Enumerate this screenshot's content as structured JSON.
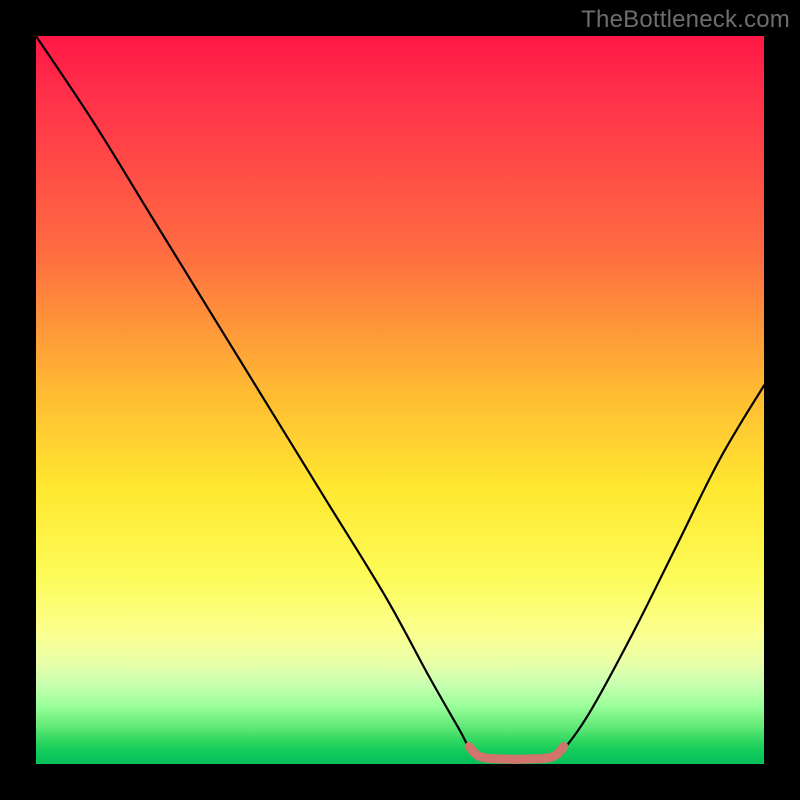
{
  "watermark": "TheBottleneck.com",
  "chart_data": {
    "type": "line",
    "title": "",
    "xlabel": "",
    "ylabel": "",
    "xlim": [
      0,
      100
    ],
    "ylim": [
      0,
      100
    ],
    "curve": {
      "name": "bottleneck-curve",
      "color": "#000000",
      "points": [
        {
          "x": 0,
          "y": 100
        },
        {
          "x": 8,
          "y": 88
        },
        {
          "x": 16,
          "y": 75
        },
        {
          "x": 24,
          "y": 62
        },
        {
          "x": 32,
          "y": 49
        },
        {
          "x": 40,
          "y": 36
        },
        {
          "x": 48,
          "y": 23
        },
        {
          "x": 54,
          "y": 12
        },
        {
          "x": 58,
          "y": 5
        },
        {
          "x": 60,
          "y": 1.5
        },
        {
          "x": 62,
          "y": 0.6
        },
        {
          "x": 66,
          "y": 0.5
        },
        {
          "x": 70,
          "y": 0.6
        },
        {
          "x": 72,
          "y": 1.5
        },
        {
          "x": 76,
          "y": 7
        },
        {
          "x": 82,
          "y": 18
        },
        {
          "x": 88,
          "y": 30
        },
        {
          "x": 94,
          "y": 42
        },
        {
          "x": 100,
          "y": 52
        }
      ]
    },
    "highlight_segment": {
      "name": "flat-bottom-highlight",
      "color": "#d1746c",
      "width": 9,
      "points": [
        {
          "x": 59.5,
          "y": 2.4
        },
        {
          "x": 61,
          "y": 1.0
        },
        {
          "x": 64,
          "y": 0.7
        },
        {
          "x": 68,
          "y": 0.7
        },
        {
          "x": 71,
          "y": 1.0
        },
        {
          "x": 72.5,
          "y": 2.4
        }
      ]
    }
  }
}
